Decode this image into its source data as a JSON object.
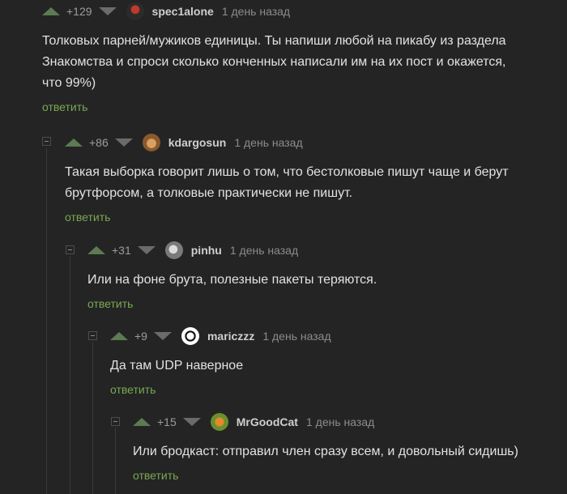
{
  "comments": [
    {
      "rating": "+129",
      "author": "spec1alone",
      "time": "1 день назад",
      "lines": [
        "Толковых парней/мужиков единицы. Ты напиши любой на пикабу из раздела",
        "Знакомства и спроси сколько конченных написали им на их пост и окажется,",
        "что 99%)"
      ],
      "reply": "ответить"
    },
    {
      "rating": "+86",
      "author": "kdargosun",
      "time": "1 день назад",
      "lines": [
        "Такая выборка говорит лишь о том, что бестолковые пишут чаще и берут",
        "брутфорсом, а толковые практически не пишут."
      ],
      "reply": "ответить"
    },
    {
      "rating": "+31",
      "author": "pinhu",
      "time": "1 день назад",
      "lines": [
        "Или на фоне брута, полезные пакеты теряются."
      ],
      "reply": "ответить"
    },
    {
      "rating": "+9",
      "author": "mariczzz",
      "time": "1 день назад",
      "lines": [
        "Да там UDP наверное"
      ],
      "reply": "ответить"
    },
    {
      "rating": "+15",
      "author": "MrGoodCat",
      "time": "1 день назад",
      "lines": [
        "Или бродкаст: отправил член сразу всем, и довольный сидишь)"
      ],
      "reply": "ответить"
    }
  ],
  "colors": {
    "background": "#242424",
    "upvote": "#5c7b52",
    "reply_link": "#7aa852",
    "thread_line": "#3a3a3a"
  }
}
